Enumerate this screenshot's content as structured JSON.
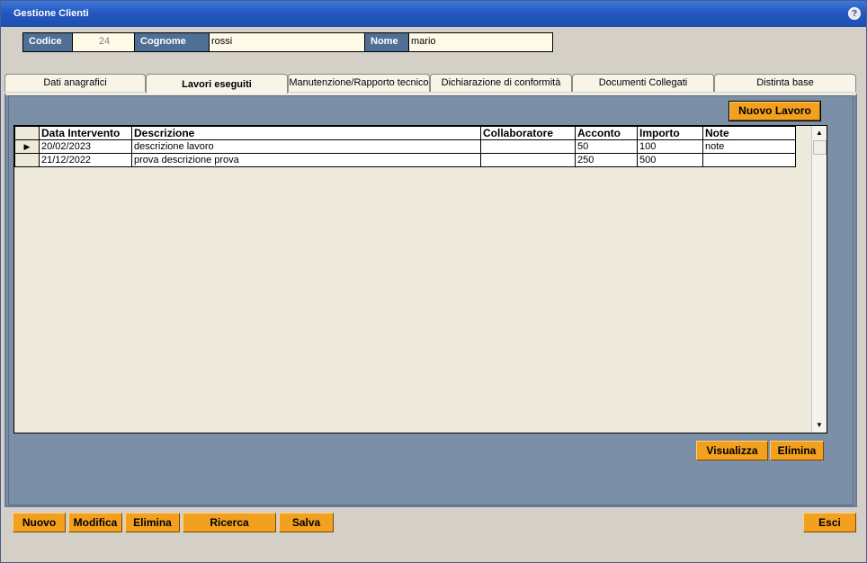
{
  "window": {
    "title": "Gestione Clienti",
    "help_glyph": "?"
  },
  "header": {
    "codice_label": "Codice",
    "codice_value": "24",
    "cognome_label": "Cognome",
    "cognome_value": "rossi",
    "nome_label": "Nome",
    "nome_value": "mario"
  },
  "tabs": [
    {
      "label": "Dati anagrafici",
      "active": false
    },
    {
      "label": "Lavori eseguiti",
      "active": true
    },
    {
      "label": "Manutenzione/Rapporto tecnico",
      "active": false
    },
    {
      "label": "Dichiarazione di conformità",
      "active": false
    },
    {
      "label": "Documenti Collegati",
      "active": false
    },
    {
      "label": "Distinta base",
      "active": false
    }
  ],
  "panel": {
    "new_work_button": "Nuovo Lavoro",
    "view_button": "Visualizza",
    "delete_button": "Elimina"
  },
  "grid": {
    "columns": [
      "Data Intervento",
      "Descrizione",
      "Collaboratore",
      "Acconto",
      "Importo",
      "Note"
    ],
    "current_row_marker": "▶",
    "rows": [
      [
        "20/02/2023",
        "descrizione lavoro",
        "",
        "50",
        "100",
        "note"
      ],
      [
        "21/12/2022",
        "prova descrizione prova",
        "",
        "250",
        "500",
        ""
      ]
    ]
  },
  "toolbar": {
    "nuovo": "Nuovo",
    "modifica": "Modifica",
    "elimina": "Elimina",
    "ricerca": "Ricerca",
    "salva": "Salva",
    "esci": "Esci"
  },
  "colors": {
    "accent_orange": "#f2a01e",
    "panel_blue": "#7b8fa6",
    "label_blue": "#4f6f95",
    "title_blue": "#2358c0"
  }
}
